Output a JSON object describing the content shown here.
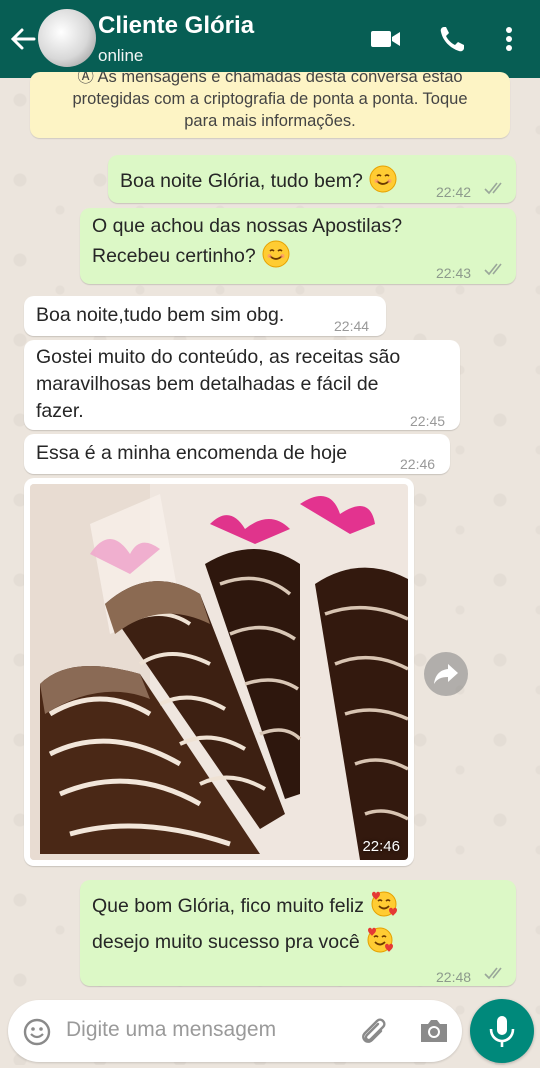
{
  "header": {
    "contact_name": "Cliente Glória",
    "status": "online",
    "icons": [
      "back-arrow-icon",
      "video-call-icon",
      "phone-icon",
      "more-options-icon"
    ]
  },
  "notice": {
    "line1": "Ⓐ As mensagens e chamadas desta conversa estão",
    "line2": "protegidas com a criptografia de ponta a ponta. Toque",
    "line3": "para mais informações."
  },
  "messages": [
    {
      "direction": "out",
      "lines": [
        "Boa noite Glória, tudo bem?"
      ],
      "emoji": "smiling-face",
      "time": "22:42",
      "status": "read"
    },
    {
      "direction": "out",
      "lines": [
        "O que achou das nossas Apostilas?",
        "Recebeu certinho?"
      ],
      "emoji": "smiling-face",
      "time": "22:43",
      "status": "read"
    },
    {
      "direction": "in",
      "lines": [
        "Boa noite,tudo bem sim obg."
      ],
      "time": "22:44"
    },
    {
      "direction": "in",
      "lines": [
        "Gostei muito do conteúdo, as receitas são",
        "maravilhosas bem detalhadas e fácil de",
        "fazer."
      ],
      "time": "22:45"
    },
    {
      "direction": "in",
      "lines": [
        "Essa é a minha encomenda de hoje"
      ],
      "time": "22:46"
    },
    {
      "direction": "in",
      "type": "image",
      "image_description": "chocolate cones with coconut and white chocolate stripes wrapped in cellophane with pink ribbons",
      "time": "22:46"
    },
    {
      "direction": "out",
      "lines": [
        "Que bom Glória, fico muito feliz",
        "desejo muito sucesso pra você"
      ],
      "emoji": "smiling-face-with-hearts",
      "time": "22:48",
      "status": "read"
    }
  ],
  "input": {
    "placeholder": "Digite uma mensagem",
    "icons": [
      "emoji-icon",
      "attach-icon",
      "camera-icon",
      "mic-icon"
    ]
  },
  "colors": {
    "header": "#075e54",
    "outgoing_bubble": "#dcf8c6",
    "incoming_bubble": "#ffffff",
    "background": "#ece5dd",
    "notice": "#fdf4c5",
    "mic_button": "#00897b"
  }
}
